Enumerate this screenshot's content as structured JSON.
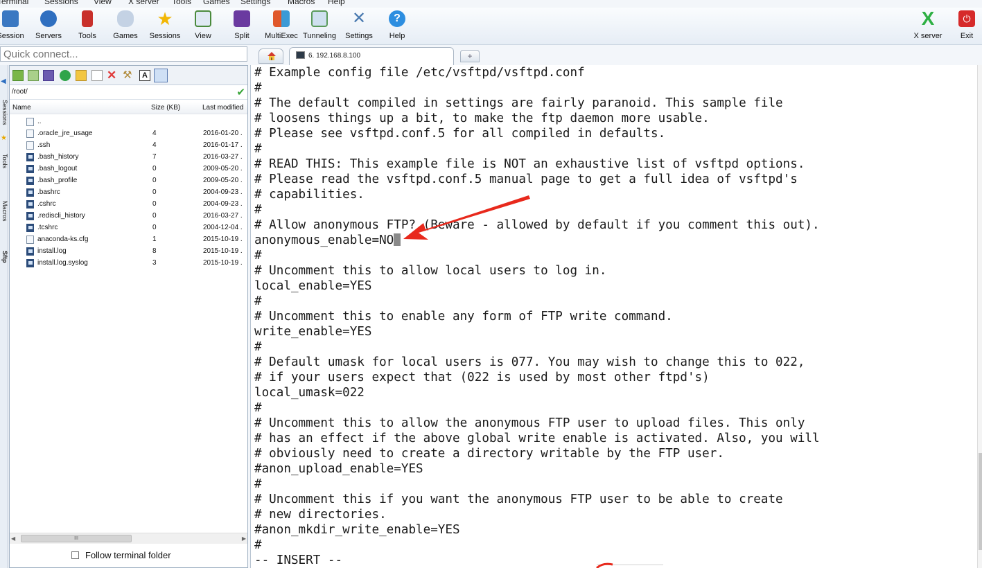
{
  "menu": [
    "Terminal",
    "Sessions",
    "View",
    "X server",
    "Tools",
    "Games",
    "Settings",
    "Macros",
    "Help"
  ],
  "toolbar": {
    "buttons": [
      {
        "label": "Session",
        "icon": "session-icon",
        "color": "#3a78c2"
      },
      {
        "label": "Servers",
        "icon": "servers-icon",
        "color": "#2f6fc0"
      },
      {
        "label": "Tools",
        "icon": "tools-icon",
        "color": "#c8302b"
      },
      {
        "label": "Games",
        "icon": "games-icon",
        "color": "#8aa0c0"
      },
      {
        "label": "Sessions",
        "icon": "sessions-star-icon",
        "color": "#f2b705"
      },
      {
        "label": "View",
        "icon": "view-icon",
        "color": "#4a8a3c"
      },
      {
        "label": "Split",
        "icon": "split-icon",
        "color": "#6a3aa0"
      },
      {
        "label": "MultiExec",
        "icon": "multiexec-icon",
        "color": "#e0582b"
      },
      {
        "label": "Tunneling",
        "icon": "tunneling-icon",
        "color": "#5a9a5a"
      },
      {
        "label": "Settings",
        "icon": "settings-icon",
        "color": "#4a7ab0"
      },
      {
        "label": "Help",
        "icon": "help-icon",
        "color": "#2d8ee0"
      }
    ],
    "right_buttons": [
      {
        "label": "X server",
        "icon": "x-server-icon",
        "color": "#2fb044"
      },
      {
        "label": "Exit",
        "icon": "exit-icon",
        "color": "#d62a2a"
      }
    ]
  },
  "quick_connect": {
    "placeholder": "Quick connect..."
  },
  "tabs": {
    "session_tab": "6. 192.168.8.100"
  },
  "side_tabs": [
    "Sessions",
    "Tools",
    "Macros",
    "Sftp"
  ],
  "sftp": {
    "path": "/root/",
    "columns": [
      "Name",
      "Size (KB)",
      "Last modified"
    ],
    "files": [
      {
        "name": "..",
        "size": "",
        "modified": "",
        "icon": "parent-folder-icon"
      },
      {
        "name": ".oracle_jre_usage",
        "size": "4",
        "modified": "2016-01-20 .",
        "icon": "folder-icon"
      },
      {
        "name": ".ssh",
        "size": "4",
        "modified": "2016-01-17 .",
        "icon": "folder-icon"
      },
      {
        "name": ".bash_history",
        "size": "7",
        "modified": "2016-03-27 .",
        "icon": "file-icon"
      },
      {
        "name": ".bash_logout",
        "size": "0",
        "modified": "2009-05-20 .",
        "icon": "file-icon"
      },
      {
        "name": ".bash_profile",
        "size": "0",
        "modified": "2009-05-20 .",
        "icon": "file-icon"
      },
      {
        "name": ".bashrc",
        "size": "0",
        "modified": "2004-09-23 .",
        "icon": "file-icon"
      },
      {
        "name": ".cshrc",
        "size": "0",
        "modified": "2004-09-23 .",
        "icon": "file-icon"
      },
      {
        "name": ".rediscli_history",
        "size": "0",
        "modified": "2016-03-27 .",
        "icon": "file-icon"
      },
      {
        "name": ".tcshrc",
        "size": "0",
        "modified": "2004-12-04 .",
        "icon": "file-icon"
      },
      {
        "name": "anaconda-ks.cfg",
        "size": "1",
        "modified": "2015-10-19 .",
        "icon": "cfg-file-icon"
      },
      {
        "name": "install.log",
        "size": "8",
        "modified": "2015-10-19 .",
        "icon": "text-file-icon"
      },
      {
        "name": "install.log.syslog",
        "size": "3",
        "modified": "2015-10-19 .",
        "icon": "text-file-icon"
      }
    ],
    "scroll_thumb_label": "III",
    "follow_label": "Follow terminal folder"
  },
  "terminal": {
    "lines": [
      "# Example config file /etc/vsftpd/vsftpd.conf",
      "#",
      "# The default compiled in settings are fairly paranoid. This sample file",
      "# loosens things up a bit, to make the ftp daemon more usable.",
      "# Please see vsftpd.conf.5 for all compiled in defaults.",
      "#",
      "# READ THIS: This example file is NOT an exhaustive list of vsftpd options.",
      "# Please read the vsftpd.conf.5 manual page to get a full idea of vsftpd's",
      "# capabilities.",
      "#",
      "# Allow anonymous FTP? (Beware - allowed by default if you comment this out).",
      "anonymous_enable=NO",
      "#",
      "# Uncomment this to allow local users to log in.",
      "local_enable=YES",
      "#",
      "# Uncomment this to enable any form of FTP write command.",
      "write_enable=YES",
      "#",
      "# Default umask for local users is 077. You may wish to change this to 022,",
      "# if your users expect that (022 is used by most other ftpd's)",
      "local_umask=022",
      "#",
      "# Uncomment this to allow the anonymous FTP user to upload files. This only",
      "# has an effect if the above global write enable is activated. Also, you will",
      "# obviously need to create a directory writable by the FTP user.",
      "#anon_upload_enable=YES",
      "#",
      "# Uncomment this if you want the anonymous FTP user to be able to create",
      "# new directories.",
      "#anon_mkdir_write_enable=YES",
      "#",
      "-- INSERT --"
    ],
    "cursor_line": 11
  },
  "colors": {
    "annotation_arrow": "#e8291c",
    "accent": "#3a78c2"
  }
}
